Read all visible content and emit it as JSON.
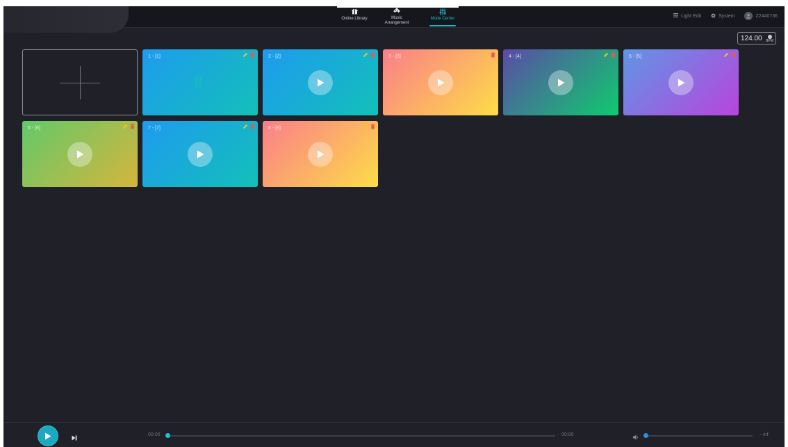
{
  "nav": {
    "tabs": [
      {
        "label": "Online Library",
        "icon": "gift-icon"
      },
      {
        "label": "Music Arrangement",
        "icon": "arrows-icon"
      },
      {
        "label": "Mode Center",
        "icon": "sliders-icon",
        "active": true
      }
    ]
  },
  "right_menu": {
    "light_edit": "Light Edit",
    "system": "System",
    "user_id": "Z2440736"
  },
  "bpm": {
    "value": "124.00",
    "unit": "BPM"
  },
  "cards": [
    {
      "title": "1 - [1]",
      "state": "playing",
      "gradient": [
        "#1e9bef",
        "#12c0b8"
      ]
    },
    {
      "title": "2 - [2]",
      "state": "stopped",
      "gradient": [
        "#1e9bef",
        "#12c0b8"
      ]
    },
    {
      "title": "3 - [3]",
      "state": "stopped",
      "gradient": [
        "#fa7e8a",
        "#fddd47"
      ]
    },
    {
      "title": "4 - [4]",
      "state": "stopped",
      "gradient": [
        "#5b4ba7",
        "#0fcb6e"
      ]
    },
    {
      "title": "5 - [5]",
      "state": "stopped",
      "gradient": [
        "#5f96e4",
        "#b944dd"
      ]
    },
    {
      "title": "6 - [6]",
      "state": "stopped",
      "gradient": [
        "#62c96a",
        "#d6b53c"
      ]
    },
    {
      "title": "7 - [7]",
      "state": "stopped",
      "gradient": [
        "#1e9bef",
        "#12c0b8"
      ]
    },
    {
      "title": "8 - [8]",
      "state": "stopped",
      "gradient": [
        "#fa7e8a",
        "#fddd47"
      ]
    }
  ],
  "player": {
    "time_start": "00:00",
    "time_end": "00:00",
    "progress": 0,
    "volume_label": "- inf",
    "volume": 0
  },
  "colors": {
    "accent": "#1fb6c7",
    "background": "#202128",
    "edit_icon": "#f5c518",
    "delete_icon": "#e45b4f"
  }
}
